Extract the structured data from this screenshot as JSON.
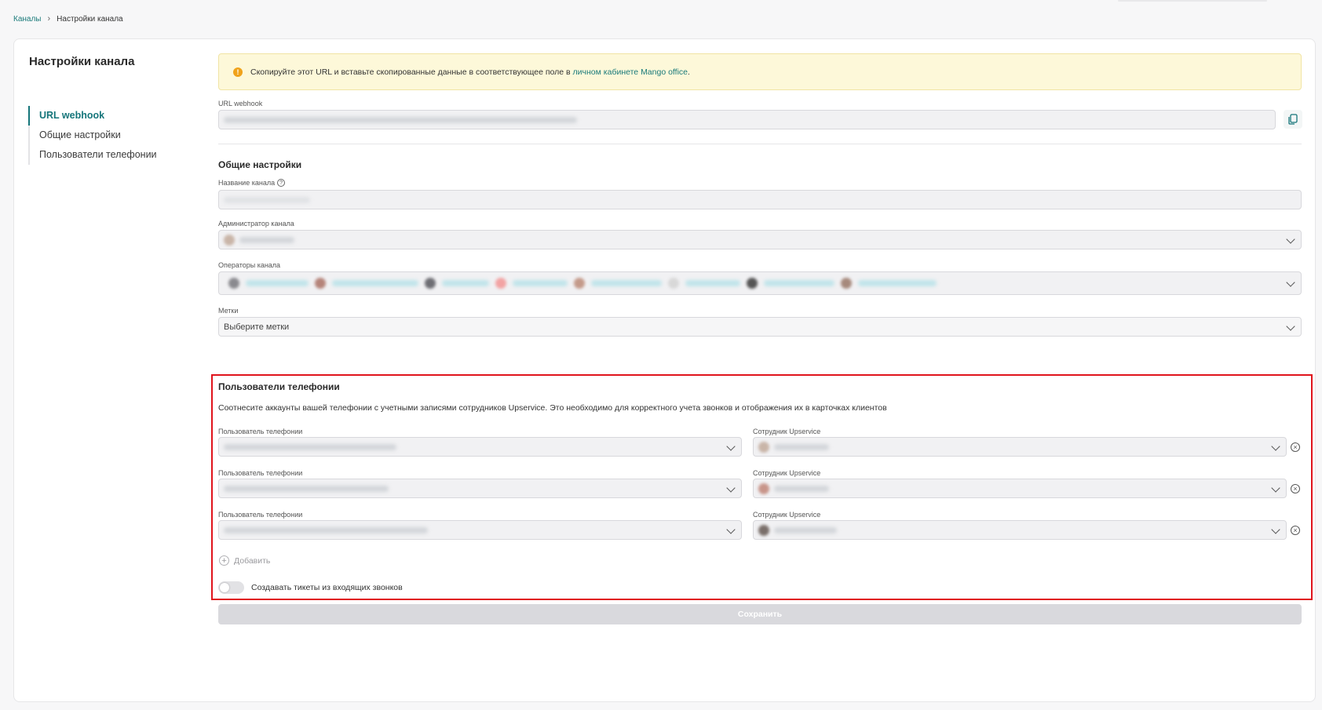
{
  "breadcrumb": {
    "root": "Каналы",
    "current": "Настройки канала"
  },
  "page": {
    "title": "Настройки канала"
  },
  "side_nav": {
    "items": [
      {
        "label": "URL webhook",
        "active": true
      },
      {
        "label": "Общие настройки",
        "active": false
      },
      {
        "label": "Пользователи телефонии",
        "active": false
      }
    ]
  },
  "alert": {
    "icon": "warning-icon",
    "text": "Скопируйте этот URL и вставьте скопированные данные в соответствующее поле в",
    "link": "личном кабинете Mango office",
    "suffix": "."
  },
  "webhook": {
    "label": "URL webhook"
  },
  "general": {
    "title": "Общие настройки",
    "channel_name_label": "Название канала",
    "admin_label": "Администратор канала",
    "operators_label": "Операторы канала",
    "tags_label": "Метки",
    "tags_placeholder": "Выберите метки"
  },
  "telephony": {
    "title": "Пользователи телефонии",
    "description": "Соотнесите аккаунты вашей телефонии с учетными записями сотрудников Upservice. Это необходимо для корректного учета звонков и отображения их в карточках клиентов",
    "user_label": "Пользователь телефонии",
    "employee_label": "Сотрудник Upservice",
    "add_label": "Добавить",
    "toggle_label": "Создавать тикеты из входящих звонков",
    "toggle_on": false
  },
  "actions": {
    "save_label": "Сохранить"
  },
  "colors": {
    "accent": "#15757a",
    "alert_bg": "#fdf8d9",
    "highlight": "#e0141c"
  }
}
